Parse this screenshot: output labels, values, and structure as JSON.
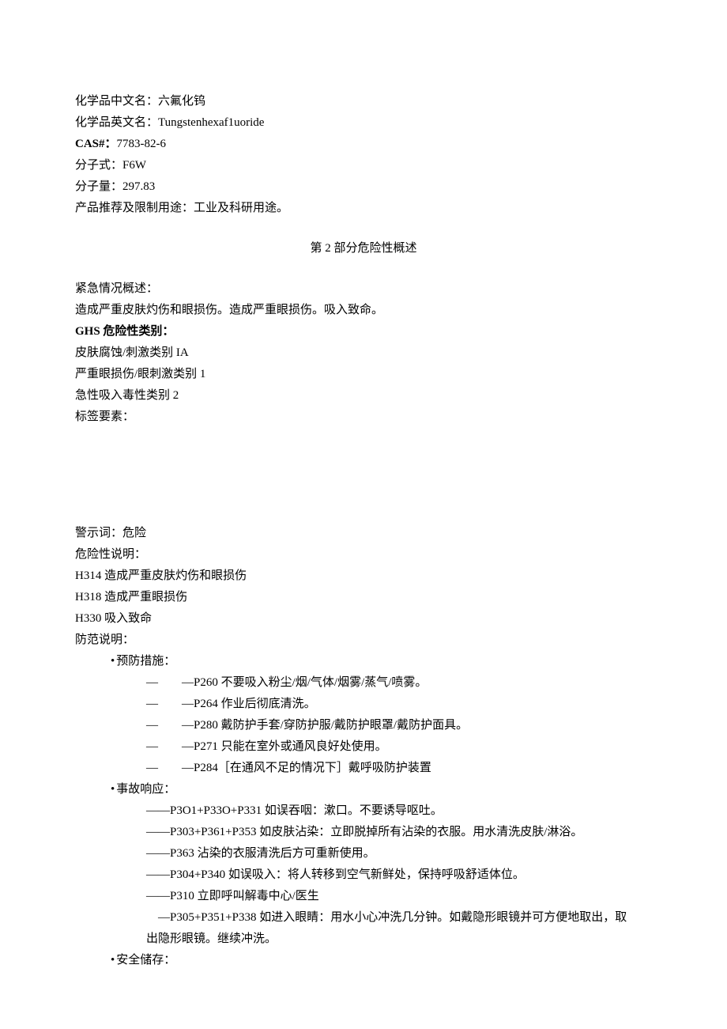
{
  "ident": {
    "name_cn_label": "化学品中文名：",
    "name_cn_value": "六氟化钨",
    "name_en_label": "化学品英文名：",
    "name_en_value": "Tungstenhexaf1uoride",
    "cas_label": "CAS#：",
    "cas_value": "7783-82-6",
    "formula_label": "分子式：",
    "formula_value": "F6W",
    "mw_label": "分子量：",
    "mw_value": "297.83",
    "use_label": "产品推荐及限制用途：",
    "use_value": "工业及科研用途。"
  },
  "section2": {
    "title": "第 2 部分危险性概述",
    "emergency_label": "紧急情况概述：",
    "emergency_text": "造成严重皮肤灼伤和眼损伤。造成严重眼损伤。吸入致命。",
    "ghs_label": "GHS 危险性类别：",
    "ghs1": "皮肤腐蚀/刺激类别 IA",
    "ghs2": "严重眼损伤/眼刺激类别 1",
    "ghs3": "急性吸入毒性类别 2",
    "label_elements": "标签要素：",
    "signal_label": "警示词：",
    "signal_value": "危险",
    "hazard_stmt_label": "危险性说明：",
    "h314": "H314 造成严重皮肤灼伤和眼损伤",
    "h318": "H318 造成严重眼损伤",
    "h330": "H330 吸入致命",
    "precaution_label": "防范说明：",
    "prevention_header": "预防措施：",
    "p260": "—P260 不要吸入粉尘/烟/气体/烟雾/蒸气/喷雾。",
    "p264": "—P264 作业后彻底清洗。",
    "p280": "—P280 戴防护手套/穿防护服/戴防护眼罩/戴防护面具。",
    "p271": "—P271 只能在室外或通风良好处使用。",
    "p284": "—P284［在通风不足的情况下］戴呼吸防护装置",
    "response_header": "事故响应：",
    "p301": "——P3O1+P33O+P331 如误吞咽：漱口。不要诱导呕吐。",
    "p303": "——P303+P361+P353 如皮肤沾染：立即脱掉所有沾染的衣服。用水清洗皮肤/淋浴。",
    "p363": "——P363 沾染的衣服清洗后方可重新使用。",
    "p304": "——P304+P340 如误吸入：将人转移到空气新鲜处，保持呼吸舒适体位。",
    "p310": "——P310 立即呼叫解毒中心/医生",
    "p305_line1": "    —P305+P351+P338 如进入眼睛：用水小心冲洗几分钟。如戴隐形眼镜并可方便地取出，取",
    "p305_line2": "出隐形眼镜。继续冲洗。",
    "storage_header": "安全储存："
  }
}
